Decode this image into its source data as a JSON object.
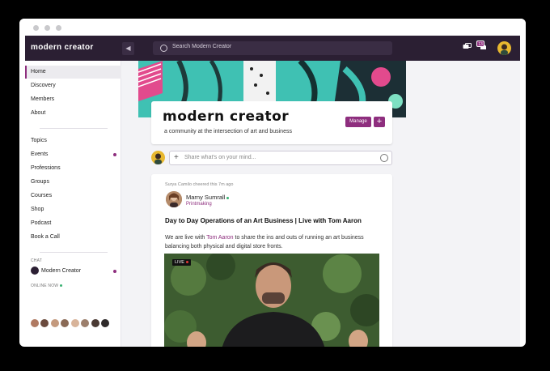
{
  "brand": "modern creator",
  "search": {
    "placeholder": "Search Modern Creator"
  },
  "notifications": {
    "count": "13"
  },
  "sidebar": {
    "primary": [
      {
        "label": "Home",
        "active": true
      },
      {
        "label": "Discovery"
      },
      {
        "label": "Members"
      },
      {
        "label": "About"
      }
    ],
    "secondary": [
      {
        "label": "Topics"
      },
      {
        "label": "Events",
        "unread": true
      },
      {
        "label": "Professions"
      },
      {
        "label": "Groups"
      },
      {
        "label": "Courses"
      },
      {
        "label": "Shop"
      },
      {
        "label": "Podcast"
      },
      {
        "label": "Book a Call"
      }
    ],
    "chat_heading": "CHAT",
    "chat_item": "Modern Creator",
    "online_heading": "ONLINE NOW"
  },
  "community": {
    "title": "modern creator",
    "tagline": "a community at the intersection of art and business",
    "manage_label": "Manage",
    "add_label": "+"
  },
  "composer": {
    "placeholder": "Share what's on your mind..."
  },
  "post": {
    "activity": "Surya Camilo cheered this 7m ago",
    "author": "Marny Sumrall",
    "author_tag": "Printmaking",
    "title": "Day to Day Operations of an Art Business | Live with Tom Aaron",
    "body_before": "We are live with ",
    "body_link": "Tom Aaron",
    "body_after": " to share the ins and outs of running an art business balancing both physical and digital store fronts.",
    "live_label": "LIVE"
  },
  "colors": {
    "accent": "#8e2e7e",
    "topbar": "#2b1f33",
    "online": "#3bb273"
  }
}
